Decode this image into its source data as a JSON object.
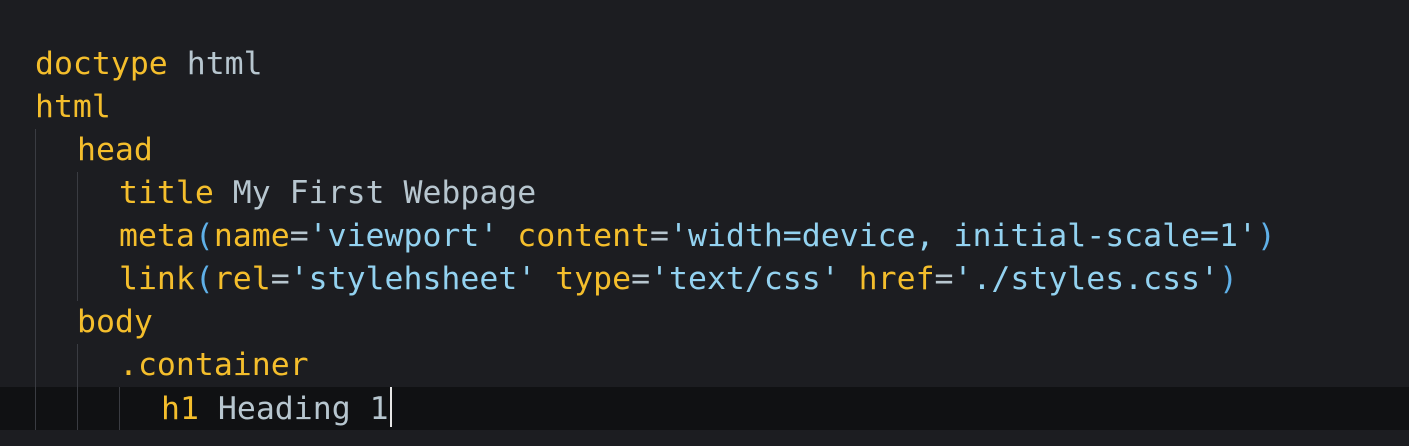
{
  "editor": {
    "language": "pug",
    "colors": {
      "background": "#1c1d21",
      "current_line": "#101113",
      "tag": "#f4be2c",
      "text": "#b7c6cf",
      "string": "#93d2f0",
      "paren": "#5fb0e8"
    },
    "lines": [
      {
        "indent": 0,
        "tokens": [
          {
            "t": "doctype",
            "k": "tag"
          },
          {
            "t": " html",
            "k": "text"
          }
        ]
      },
      {
        "indent": 0,
        "tokens": [
          {
            "t": "html",
            "k": "tag"
          }
        ]
      },
      {
        "indent": 1,
        "tokens": [
          {
            "t": "head",
            "k": "tag"
          }
        ]
      },
      {
        "indent": 2,
        "tokens": [
          {
            "t": "title",
            "k": "tag"
          },
          {
            "t": " My First Webpage",
            "k": "text"
          }
        ]
      },
      {
        "indent": 2,
        "tokens": [
          {
            "t": "meta",
            "k": "tag"
          },
          {
            "t": "(",
            "k": "punc"
          },
          {
            "t": "name",
            "k": "attr"
          },
          {
            "t": "=",
            "k": "op"
          },
          {
            "t": "'viewport'",
            "k": "str"
          },
          {
            "t": " ",
            "k": "text"
          },
          {
            "t": "content",
            "k": "attr"
          },
          {
            "t": "=",
            "k": "op"
          },
          {
            "t": "'width=device, initial-scale=1'",
            "k": "str"
          },
          {
            "t": ")",
            "k": "punc"
          }
        ]
      },
      {
        "indent": 2,
        "tokens": [
          {
            "t": "link",
            "k": "tag"
          },
          {
            "t": "(",
            "k": "punc"
          },
          {
            "t": "rel",
            "k": "attr"
          },
          {
            "t": "=",
            "k": "op"
          },
          {
            "t": "'stylehsheet'",
            "k": "str"
          },
          {
            "t": " ",
            "k": "text"
          },
          {
            "t": "type",
            "k": "attr"
          },
          {
            "t": "=",
            "k": "op"
          },
          {
            "t": "'text/css'",
            "k": "str"
          },
          {
            "t": " ",
            "k": "text"
          },
          {
            "t": "href",
            "k": "attr"
          },
          {
            "t": "=",
            "k": "op"
          },
          {
            "t": "'./styles.css'",
            "k": "str"
          },
          {
            "t": ")",
            "k": "punc"
          }
        ]
      },
      {
        "indent": 1,
        "tokens": [
          {
            "t": "body",
            "k": "tag"
          }
        ]
      },
      {
        "indent": 2,
        "tokens": [
          {
            "t": ".container",
            "k": "tag"
          }
        ]
      },
      {
        "indent": 3,
        "current": true,
        "tokens": [
          {
            "t": "h1",
            "k": "tag"
          },
          {
            "t": " Heading 1",
            "k": "text"
          }
        ]
      }
    ]
  }
}
